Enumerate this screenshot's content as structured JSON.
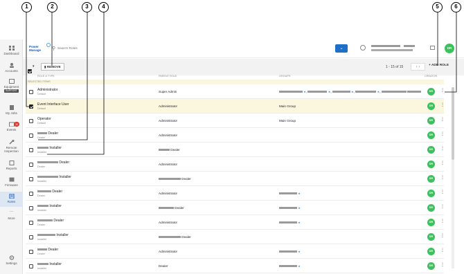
{
  "header": {
    "logo_text": "Power Manage",
    "search_placeholder": "Search Roles",
    "avatar_initials": "DR"
  },
  "sidebar": {
    "items": [
      {
        "label": "Dashboard",
        "icon": "dashboard-icon"
      },
      {
        "label": "Accounts",
        "icon": "accounts-icon"
      },
      {
        "label": "Equipment",
        "icon": "equipment-icon",
        "pill": "SUPPORT"
      },
      {
        "label": "My Jobs",
        "icon": "jobs-icon"
      },
      {
        "label": "Events",
        "icon": "events-icon",
        "badge": "11"
      },
      {
        "label": "Remote Inspection",
        "icon": "wrench-icon"
      },
      {
        "label": "Reports",
        "icon": "reports-icon"
      },
      {
        "label": "Firmware",
        "icon": "firmware-icon"
      },
      {
        "label": "Roles",
        "icon": "roles-icon",
        "active": true
      },
      {
        "label": "More",
        "icon": "more-icon"
      },
      {
        "label": "Settings",
        "icon": "settings-icon"
      }
    ]
  },
  "toolbar": {
    "remove_label": "REMOVE",
    "paging": "1 - 15 of 15",
    "add_role_label": "ADD ROLE"
  },
  "table": {
    "headers": [
      "ROLE & TYPE",
      "PARENT ROLE",
      "GROUPS",
      "CREATOR"
    ],
    "selected_label": "SELECTED ITEMS",
    "rows": [
      {
        "name": "Administrator",
        "type": "Default",
        "parent": "Super Admin",
        "groups": "",
        "creator": "DR",
        "checked": false
      },
      {
        "name": "Event Interface User",
        "type": "Default",
        "parent": "Administrator",
        "groups": "Main Group",
        "creator": "DR",
        "checked": true
      },
      {
        "name": "Operator",
        "type": "Default",
        "parent": "Administrator",
        "groups": "Main Group",
        "creator": "DR",
        "checked": false
      },
      {
        "name": "Dealer",
        "type": "Dealer",
        "parent": "Administrator",
        "groups": "",
        "creator": "DR",
        "checked": false
      },
      {
        "name": "Installer",
        "type": "Installer",
        "parent": "Dealer",
        "groups": "",
        "creator": "DR",
        "checked": false
      },
      {
        "name": "Dealer",
        "type": "Dealer",
        "parent": "Administrator",
        "groups": "",
        "creator": "DR",
        "checked": false
      },
      {
        "name": "Installer",
        "type": "Installer",
        "parent": "Dealer",
        "groups": "",
        "creator": "DR",
        "checked": false
      },
      {
        "name": "Dealer",
        "type": "Dealer",
        "parent": "Administrator",
        "groups": "",
        "creator": "DR",
        "checked": false
      },
      {
        "name": "Installer",
        "type": "Installer",
        "parent": "Dealer",
        "groups": "",
        "creator": "DR",
        "checked": false
      },
      {
        "name": "Dealer",
        "type": "Dealer",
        "parent": "Administrator",
        "groups": "",
        "creator": "DR",
        "checked": false
      },
      {
        "name": "Installer",
        "type": "Installer",
        "parent": "Dealer",
        "groups": "",
        "creator": "DR",
        "checked": false
      },
      {
        "name": "Dealer",
        "type": "Dealer",
        "parent": "Administrator",
        "groups": "",
        "creator": "DR",
        "checked": false
      },
      {
        "name": "Installer",
        "type": "Installer",
        "parent": "Dealer",
        "groups": "",
        "creator": "DR",
        "checked": false
      }
    ]
  },
  "callouts": [
    "1",
    "2",
    "3",
    "4",
    "5",
    "6"
  ]
}
